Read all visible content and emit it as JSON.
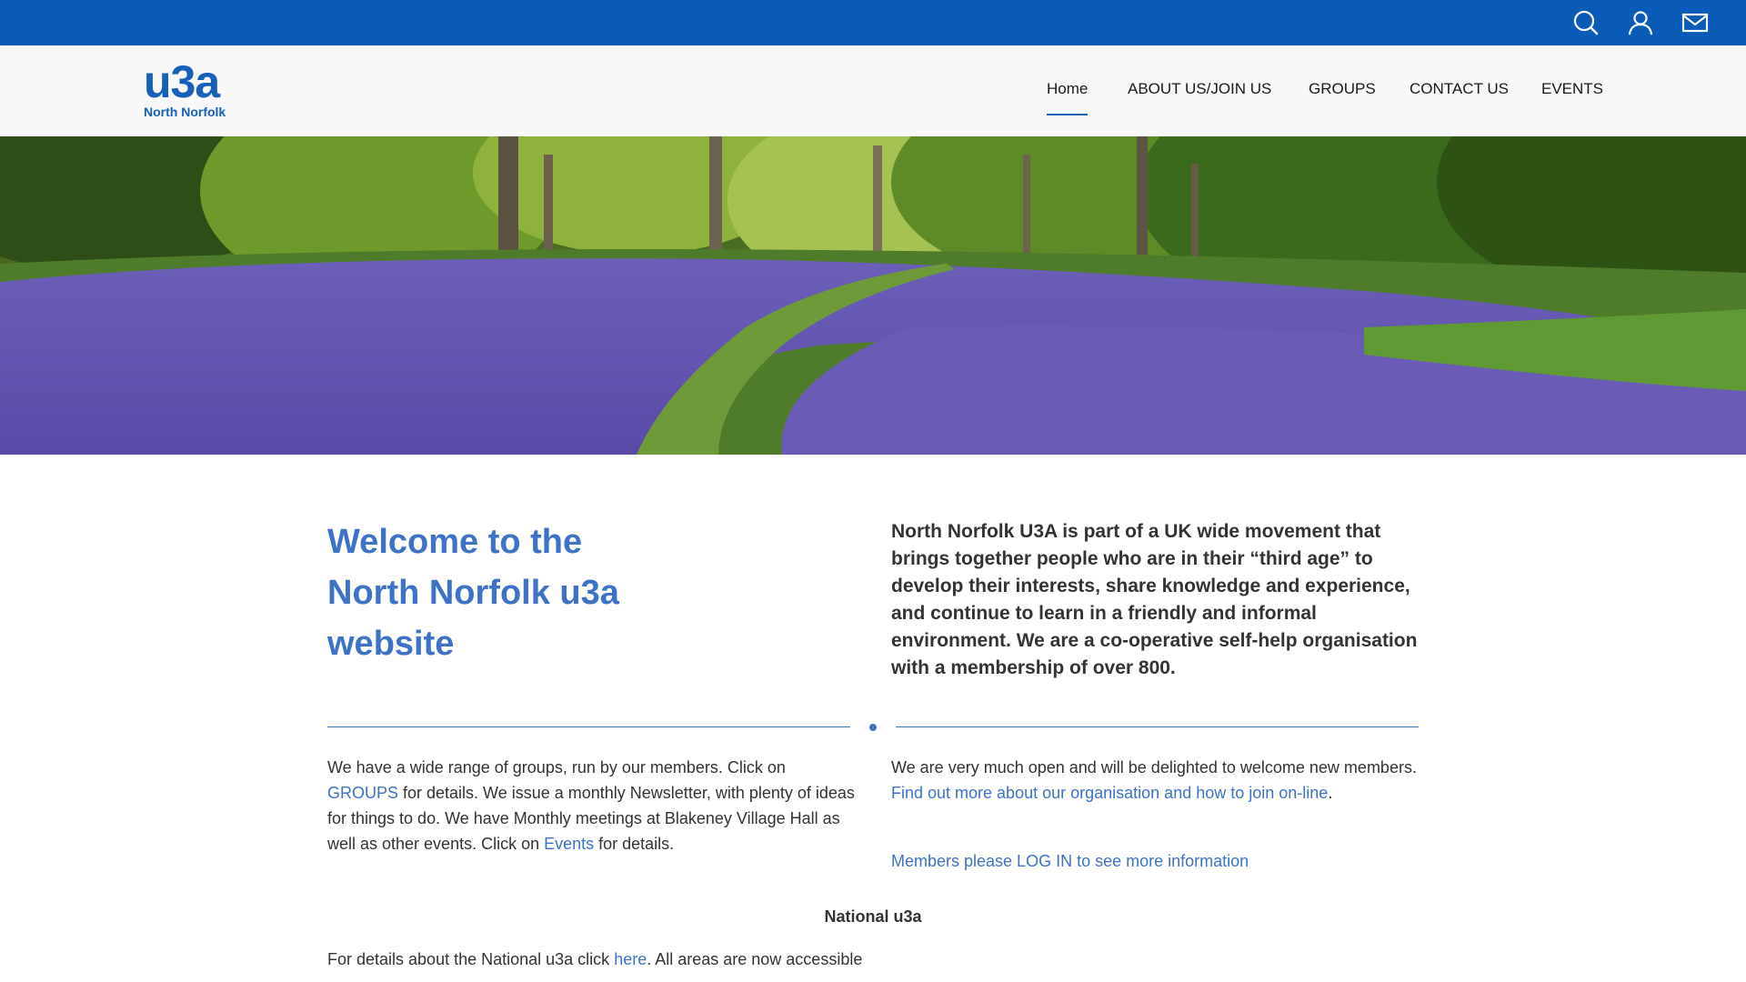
{
  "topbar": {
    "icons": [
      "search-icon",
      "user-icon",
      "mail-icon"
    ],
    "color": "#0a5ab8"
  },
  "header": {
    "logo": {
      "mark": "u3a",
      "subtitle": "North Norfolk"
    },
    "nav": [
      {
        "label": "Home",
        "active": true
      },
      {
        "label": "ABOUT US/JOIN US",
        "active": false
      },
      {
        "label": "GROUPS",
        "active": false
      },
      {
        "label": "CONTACT US",
        "active": false
      },
      {
        "label": "EVENTS",
        "active": false
      }
    ]
  },
  "hero": {
    "description_icon": "bluebell-woodland-image"
  },
  "main": {
    "welcome_line1": "Welcome to the",
    "welcome_line2": "North Norfolk u3a",
    "welcome_line3": "website",
    "intro": "North Norfolk U3A is part of a UK wide movement that brings together people who are in their “third age” to develop their interests, share knowledge and experience, and continue to learn in a friendly and informal environment. We are a co-operative self-help organisation with a membership of over 800.",
    "left": {
      "part1": "We have a wide range of groups, run by our members. Click on ",
      "link1": "GROUPS",
      "part2": " for details. We issue a monthly Newsletter, with plenty of ideas for things to do. We have Monthly meetings at Blakeney Village Hall as well as other events. Click on ",
      "link2": "Events",
      "part3": " for details."
    },
    "right": {
      "part1": "We are very much open and will be delighted to welcome new members. ",
      "link": "Find out more about our organisation and how to join on-line",
      "part2": "."
    },
    "login_link": "Members please LOG IN to see more information",
    "national_heading": "National u3a",
    "national": {
      "part1": "For details about the National u3a click ",
      "link": "here",
      "part2": ". All areas are now accessible"
    }
  },
  "colors": {
    "brand": "#1760b8",
    "accent": "#3d72c6",
    "text": "#333333"
  }
}
